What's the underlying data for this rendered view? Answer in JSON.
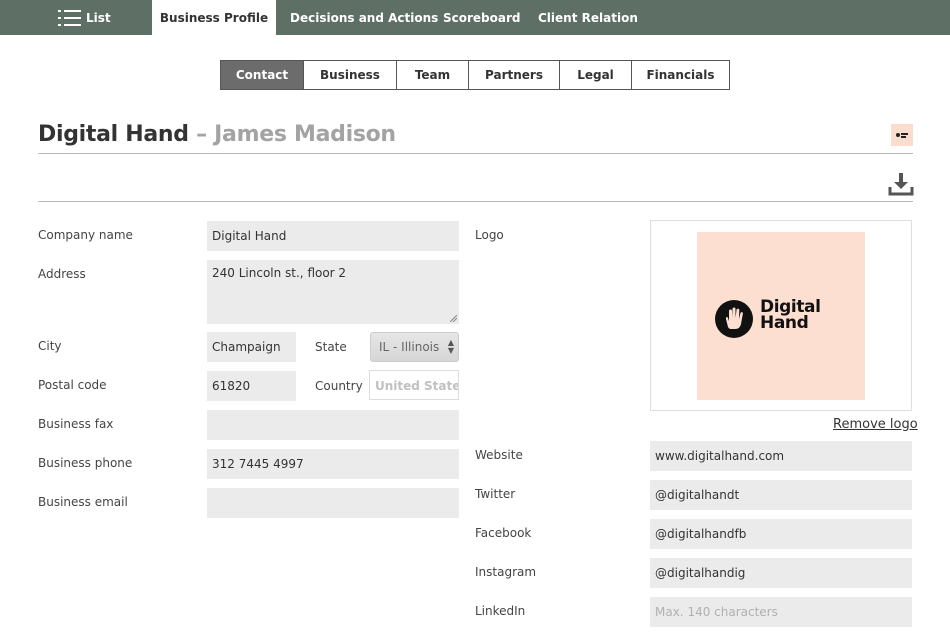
{
  "nav": {
    "list_label": "List",
    "tabs": [
      "Business Profile",
      "Decisions and Actions",
      "Scoreboard",
      "Client Relation"
    ],
    "active": "Business Profile"
  },
  "subtabs": {
    "items": [
      "Contact",
      "Business",
      "Team",
      "Partners",
      "Legal",
      "Financials"
    ],
    "active": "Contact"
  },
  "header": {
    "company": "Digital Hand",
    "separator": " – ",
    "person": "James Madison"
  },
  "form": {
    "company_name": {
      "label": "Company name",
      "value": "Digital Hand"
    },
    "address": {
      "label": "Address",
      "value": "240 Lincoln st., floor 2"
    },
    "city": {
      "label": "City",
      "value": "Champaign"
    },
    "state": {
      "label": "State",
      "value": "IL - Illinois"
    },
    "postal_code": {
      "label": "Postal code",
      "value": "61820"
    },
    "country": {
      "label": "Country",
      "value": "United States"
    },
    "business_fax": {
      "label": "Business fax",
      "value": ""
    },
    "business_phone": {
      "label": "Business phone",
      "value": "312 7445 4997"
    },
    "business_email": {
      "label": "Business email",
      "value": ""
    }
  },
  "logo": {
    "label": "Logo",
    "text_line1": "Digital",
    "text_line2": "Hand",
    "remove_label": "Remove logo",
    "bg_color": "#fddfd2"
  },
  "social": {
    "website": {
      "label": "Website",
      "value": "www.digitalhand.com"
    },
    "twitter": {
      "label": "Twitter",
      "value": "@digitalhandt"
    },
    "facebook": {
      "label": "Facebook",
      "value": "@digitalhandfb"
    },
    "instagram": {
      "label": "Instagram",
      "value": "@digitalhandig"
    },
    "linkedin": {
      "label": "LinkedIn",
      "value": "",
      "placeholder": "Max. 140 characters"
    }
  },
  "colors": {
    "nav_bg": "#5e6f65",
    "field_bg": "#ebebeb",
    "subtab_active": "#6c6c6c"
  },
  "icons": {
    "menu": "hamburger-icon",
    "download": "download-icon",
    "select": "up-down-arrows-icon"
  }
}
